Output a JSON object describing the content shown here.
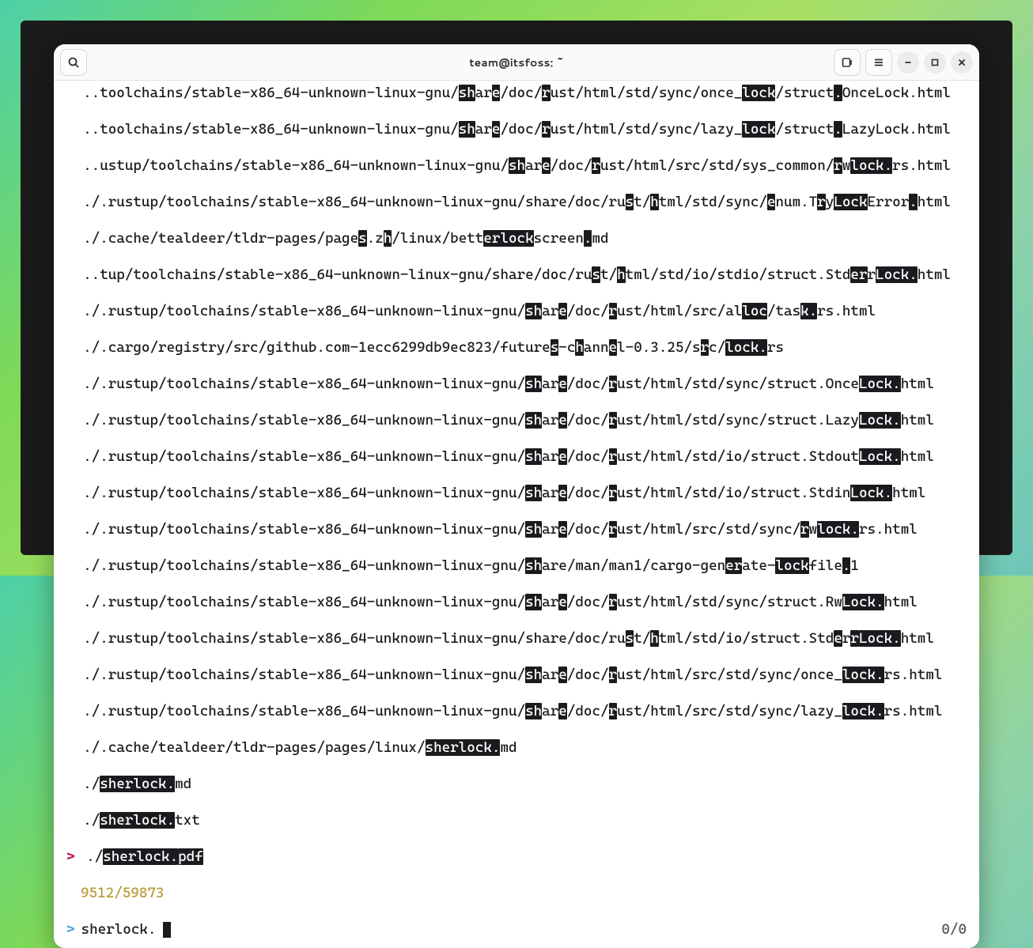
{
  "window": {
    "title": "team@itsfoss: ~"
  },
  "lines": [
    {
      "pre": "  ..toolchains/stable-x86_64-unknown-linux-gnu/",
      "segments": [
        [
          "sh",
          1
        ],
        [
          "ar",
          0
        ],
        [
          "e",
          1
        ],
        [
          "/doc/",
          0
        ],
        [
          "r",
          1
        ],
        [
          "ust/html/std/sync/once_",
          0
        ],
        [
          "lock",
          1
        ],
        [
          "/struct",
          0
        ],
        [
          ".",
          1
        ],
        [
          "OnceLock.html",
          0
        ]
      ]
    },
    {
      "pre": "  ..toolchains/stable-x86_64-unknown-linux-gnu/",
      "segments": [
        [
          "sh",
          1
        ],
        [
          "ar",
          0
        ],
        [
          "e",
          1
        ],
        [
          "/doc/",
          0
        ],
        [
          "r",
          1
        ],
        [
          "ust/html/std/sync/lazy_",
          0
        ],
        [
          "lock",
          1
        ],
        [
          "/struct",
          0
        ],
        [
          ".",
          1
        ],
        [
          "LazyLock.html",
          0
        ]
      ]
    },
    {
      "pre": "  ..ustup/toolchains/stable-x86_64-unknown-linux-gnu/",
      "segments": [
        [
          "sh",
          1
        ],
        [
          "ar",
          0
        ],
        [
          "e",
          1
        ],
        [
          "/doc/",
          0
        ],
        [
          "r",
          1
        ],
        [
          "ust/html/src/std/sys_common/",
          0
        ],
        [
          "r",
          1
        ],
        [
          "w",
          0
        ],
        [
          "lock.",
          1
        ],
        [
          "rs.html",
          0
        ]
      ]
    },
    {
      "pre": "  ./.rustup/toolchains/stable-x86_64-unknown-linux-gnu/share/doc/ru",
      "segments": [
        [
          "s",
          1
        ],
        [
          "t/",
          0
        ],
        [
          "h",
          1
        ],
        [
          "tml/std/sync/",
          0
        ],
        [
          "e",
          1
        ],
        [
          "num.T",
          0
        ],
        [
          "r",
          1
        ],
        [
          "y",
          0
        ],
        [
          "Lock",
          1
        ],
        [
          "Error",
          0
        ],
        [
          ".",
          1
        ],
        [
          "html",
          0
        ]
      ]
    },
    {
      "pre": "  ./.cache/tealdeer/tldr-pages/page",
      "segments": [
        [
          "s",
          1
        ],
        [
          ".z",
          0
        ],
        [
          "h",
          1
        ],
        [
          "/linux/bett",
          0
        ],
        [
          "erlock",
          1
        ],
        [
          "screen",
          0
        ],
        [
          ".",
          1
        ],
        [
          "md",
          0
        ]
      ]
    },
    {
      "pre": "  ..tup/toolchains/stable-x86_64-unknown-linux-gnu/share/doc/ru",
      "segments": [
        [
          "s",
          1
        ],
        [
          "t/",
          0
        ],
        [
          "h",
          1
        ],
        [
          "tml/std/io/stdio/struct.Std",
          0
        ],
        [
          "er",
          1
        ],
        [
          "r",
          0
        ],
        [
          "Lock.",
          1
        ],
        [
          "html",
          0
        ]
      ]
    },
    {
      "pre": "  ./.rustup/toolchains/stable-x86_64-unknown-linux-gnu/",
      "segments": [
        [
          "sh",
          1
        ],
        [
          "ar",
          0
        ],
        [
          "e",
          1
        ],
        [
          "/doc/",
          0
        ],
        [
          "r",
          1
        ],
        [
          "ust/html/src/al",
          0
        ],
        [
          "loc",
          1
        ],
        [
          "/tas",
          0
        ],
        [
          "k.",
          1
        ],
        [
          "rs.html",
          0
        ]
      ]
    },
    {
      "pre": "  ./.cargo/registry/src/github.com-1ecc6299db9ec823/future",
      "segments": [
        [
          "s",
          1
        ],
        [
          "-c",
          0
        ],
        [
          "h",
          1
        ],
        [
          "ann",
          0
        ],
        [
          "e",
          1
        ],
        [
          "l-0.3.25/s",
          0
        ],
        [
          "r",
          1
        ],
        [
          "c/",
          0
        ],
        [
          "lock.",
          1
        ],
        [
          "rs",
          0
        ]
      ]
    },
    {
      "pre": "  ./.rustup/toolchains/stable-x86_64-unknown-linux-gnu/",
      "segments": [
        [
          "sh",
          1
        ],
        [
          "ar",
          0
        ],
        [
          "e",
          1
        ],
        [
          "/doc/",
          0
        ],
        [
          "r",
          1
        ],
        [
          "ust/html/std/sync/struct.Once",
          0
        ],
        [
          "Lock.",
          1
        ],
        [
          "html",
          0
        ]
      ]
    },
    {
      "pre": "  ./.rustup/toolchains/stable-x86_64-unknown-linux-gnu/",
      "segments": [
        [
          "sh",
          1
        ],
        [
          "ar",
          0
        ],
        [
          "e",
          1
        ],
        [
          "/doc/",
          0
        ],
        [
          "r",
          1
        ],
        [
          "ust/html/std/sync/struct.Lazy",
          0
        ],
        [
          "Lock.",
          1
        ],
        [
          "html",
          0
        ]
      ]
    },
    {
      "pre": "  ./.rustup/toolchains/stable-x86_64-unknown-linux-gnu/",
      "segments": [
        [
          "sh",
          1
        ],
        [
          "ar",
          0
        ],
        [
          "e",
          1
        ],
        [
          "/doc/",
          0
        ],
        [
          "r",
          1
        ],
        [
          "ust/html/std/io/struct.Stdout",
          0
        ],
        [
          "Lock.",
          1
        ],
        [
          "html",
          0
        ]
      ]
    },
    {
      "pre": "  ./.rustup/toolchains/stable-x86_64-unknown-linux-gnu/",
      "segments": [
        [
          "sh",
          1
        ],
        [
          "ar",
          0
        ],
        [
          "e",
          1
        ],
        [
          "/doc/",
          0
        ],
        [
          "r",
          1
        ],
        [
          "ust/html/std/io/struct.Stdin",
          0
        ],
        [
          "Lock.",
          1
        ],
        [
          "html",
          0
        ]
      ]
    },
    {
      "pre": "  ./.rustup/toolchains/stable-x86_64-unknown-linux-gnu/",
      "segments": [
        [
          "sh",
          1
        ],
        [
          "ar",
          0
        ],
        [
          "e",
          1
        ],
        [
          "/doc/",
          0
        ],
        [
          "r",
          1
        ],
        [
          "ust/html/src/std/sync/",
          0
        ],
        [
          "r",
          1
        ],
        [
          "w",
          0
        ],
        [
          "lock.",
          1
        ],
        [
          "rs.html",
          0
        ]
      ]
    },
    {
      "pre": "  ./.rustup/toolchains/stable-x86_64-unknown-linux-gnu/",
      "segments": [
        [
          "sh",
          1
        ],
        [
          "are/man/man1/cargo-gen",
          0
        ],
        [
          "er",
          1
        ],
        [
          "ate-",
          0
        ],
        [
          "lock",
          1
        ],
        [
          "file",
          0
        ],
        [
          ".",
          1
        ],
        [
          "1",
          0
        ]
      ]
    },
    {
      "pre": "  ./.rustup/toolchains/stable-x86_64-unknown-linux-gnu/",
      "segments": [
        [
          "sh",
          1
        ],
        [
          "ar",
          0
        ],
        [
          "e",
          1
        ],
        [
          "/doc/",
          0
        ],
        [
          "r",
          1
        ],
        [
          "ust/html/std/sync/struct.Rw",
          0
        ],
        [
          "Lock.",
          1
        ],
        [
          "html",
          0
        ]
      ]
    },
    {
      "pre": "  ./.rustup/toolchains/stable-x86_64-unknown-linux-gnu/share/doc/ru",
      "segments": [
        [
          "s",
          1
        ],
        [
          "t/",
          0
        ],
        [
          "h",
          1
        ],
        [
          "tml/std/io/struct.Std",
          0
        ],
        [
          "e",
          1
        ],
        [
          "r",
          0
        ],
        [
          "r",
          1
        ],
        [
          "Lock.",
          1
        ],
        [
          "html",
          0
        ]
      ]
    },
    {
      "pre": "  ./.rustup/toolchains/stable-x86_64-unknown-linux-gnu/",
      "segments": [
        [
          "sh",
          1
        ],
        [
          "ar",
          0
        ],
        [
          "e",
          1
        ],
        [
          "/doc/",
          0
        ],
        [
          "r",
          1
        ],
        [
          "ust/html/src/std/sync/once_",
          0
        ],
        [
          "lock.",
          1
        ],
        [
          "rs.html",
          0
        ]
      ]
    },
    {
      "pre": "  ./.rustup/toolchains/stable-x86_64-unknown-linux-gnu/",
      "segments": [
        [
          "sh",
          1
        ],
        [
          "ar",
          0
        ],
        [
          "e",
          1
        ],
        [
          "/doc/",
          0
        ],
        [
          "r",
          1
        ],
        [
          "ust/html/src/std/sync/lazy_",
          0
        ],
        [
          "lock.",
          1
        ],
        [
          "rs.html",
          0
        ]
      ]
    },
    {
      "pre": "  ./.cache/tealdeer/tldr-pages/pages/linux/",
      "segments": [
        [
          "sherlock.",
          1
        ],
        [
          "md",
          0
        ]
      ]
    },
    {
      "pre": "  ./",
      "segments": [
        [
          "sherlock.",
          1
        ],
        [
          "md",
          0
        ]
      ]
    },
    {
      "pre": "  ./",
      "segments": [
        [
          "sherlock.",
          1
        ],
        [
          "txt",
          0
        ]
      ]
    }
  ],
  "selected": {
    "gutter": ">",
    "pre": "./",
    "segments": [
      [
        "sherlock.",
        1
      ],
      [
        "pdf",
        1
      ]
    ]
  },
  "count": "9512/59873",
  "prompt": {
    "symbol": ">",
    "query": "sherlock."
  },
  "page": "0/0"
}
